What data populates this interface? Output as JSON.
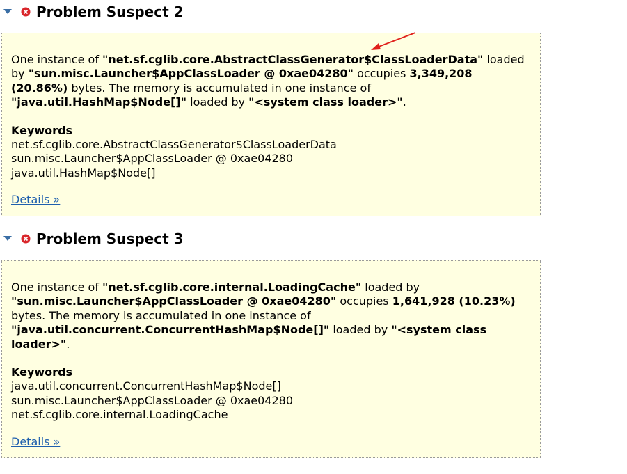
{
  "suspects": [
    {
      "title": "Problem Suspect 2",
      "desc": {
        "t1": "One instance of ",
        "b1": "\"net.sf.cglib.core.AbstractClassGenerator$ClassLoaderData\"",
        "t2": " loaded by ",
        "b2": "\"sun.misc.Launcher$AppClassLoader @ 0xae04280\"",
        "t3": " occupies ",
        "b3": "3,349,208 (20.86%)",
        "t4": " bytes. The memory is accumulated in one instance of ",
        "b4": "\"java.util.HashMap$Node[]\"",
        "t5": " loaded by ",
        "b5": "\"<system class loader>\"",
        "t6": "."
      },
      "keywords_heading": "Keywords",
      "keywords": [
        "net.sf.cglib.core.AbstractClassGenerator$ClassLoaderData",
        "sun.misc.Launcher$AppClassLoader @ 0xae04280",
        "java.util.HashMap$Node[]"
      ],
      "details_link": "Details »"
    },
    {
      "title": "Problem Suspect 3",
      "desc": {
        "t1": "One instance of ",
        "b1": "\"net.sf.cglib.core.internal.LoadingCache\"",
        "t2": " loaded by ",
        "b2": "\"sun.misc.Launcher$AppClassLoader @ 0xae04280\"",
        "t3": " occupies ",
        "b3": "1,641,928 (10.23%)",
        "t4": " bytes. The memory is accumulated in one instance of ",
        "b4": "\"java.util.concurrent.ConcurrentHashMap$Node[]\"",
        "t5": " loaded by ",
        "b5": "\"<system class loader>\"",
        "t6": "."
      },
      "keywords_heading": "Keywords",
      "keywords": [
        "java.util.concurrent.ConcurrentHashMap$Node[]",
        "sun.misc.Launcher$AppClassLoader @ 0xae04280",
        "net.sf.cglib.core.internal.LoadingCache"
      ],
      "details_link": "Details »"
    }
  ],
  "colors": {
    "box_background": "#ffffe1",
    "link": "#1f5fae",
    "toggle": "#3a6ea5",
    "error_icon": "#d9262b",
    "annotation_arrow": "#e0201b"
  },
  "icons": {
    "toggle": "triangle-down-icon",
    "status": "error-x-icon",
    "annotation": "red-arrow-annotation"
  }
}
